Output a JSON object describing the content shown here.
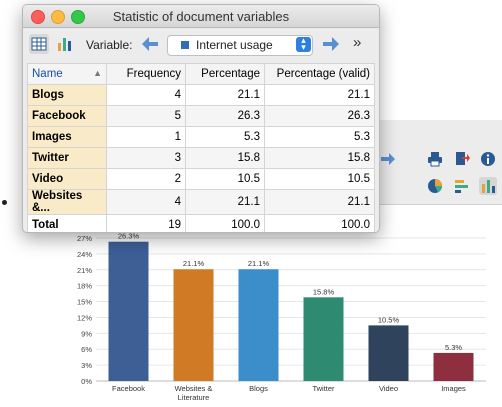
{
  "dialog": {
    "title": "Statistic of document variables",
    "variable_label": "Variable:",
    "variable_value": "Internet usage"
  },
  "table": {
    "headers": [
      "Name",
      "Frequency",
      "Percentage",
      "Percentage (valid)"
    ],
    "rows": [
      {
        "name": "Blogs",
        "frequency": "4",
        "percentage": "21.1",
        "valid": "21.1"
      },
      {
        "name": "Facebook",
        "frequency": "5",
        "percentage": "26.3",
        "valid": "26.3"
      },
      {
        "name": "Images",
        "frequency": "1",
        "percentage": "5.3",
        "valid": "5.3"
      },
      {
        "name": "Twitter",
        "frequency": "3",
        "percentage": "15.8",
        "valid": "15.8"
      },
      {
        "name": "Video",
        "frequency": "2",
        "percentage": "10.5",
        "valid": "10.5"
      },
      {
        "name": "Websites &...",
        "frequency": "4",
        "percentage": "21.1",
        "valid": "21.1"
      }
    ],
    "total": {
      "name": "Total",
      "frequency": "19",
      "percentage": "100.0",
      "valid": "100.0"
    }
  },
  "colors": {
    "accent_blue": "#2e7fe0",
    "name_cell_bg": "#faebc8"
  },
  "chart_data": {
    "type": "bar",
    "categories": [
      "Facebook",
      "Websites & Literature",
      "Blogs",
      "Twitter",
      "Video",
      "Images"
    ],
    "category_lines": [
      [
        "Facebook"
      ],
      [
        "Websites &",
        "Literature"
      ],
      [
        "Blogs"
      ],
      [
        "Twitter"
      ],
      [
        "Video"
      ],
      [
        "Images"
      ]
    ],
    "values": [
      26.3,
      21.1,
      21.1,
      15.8,
      10.5,
      5.3
    ],
    "value_labels": [
      "26.3%",
      "21.1%",
      "21.1%",
      "15.8%",
      "10.5%",
      "5.3%"
    ],
    "bar_colors": [
      "#3d5f96",
      "#d07a26",
      "#3b8ec9",
      "#2f8a72",
      "#2f435c",
      "#8e2f3f"
    ],
    "yticks": [
      "0%",
      "3%",
      "6%",
      "9%",
      "12%",
      "15%",
      "18%",
      "21%",
      "24%",
      "27%"
    ],
    "ylim": [
      0,
      27
    ],
    "grid": true,
    "title": "",
    "xlabel": "",
    "ylabel": ""
  }
}
